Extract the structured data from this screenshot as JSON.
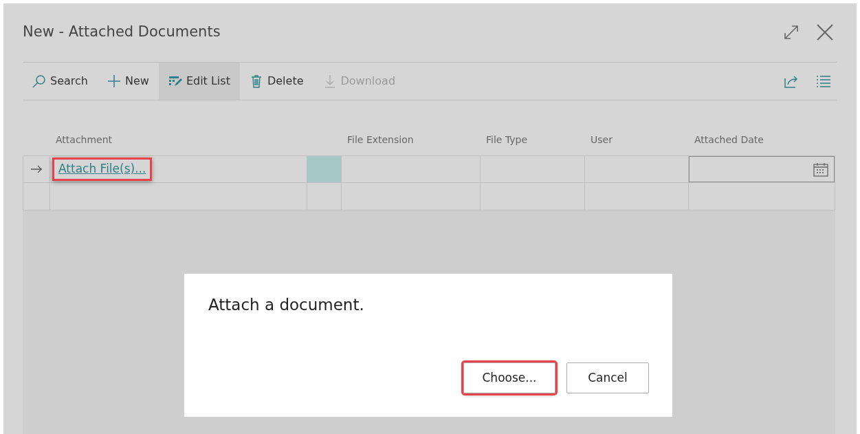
{
  "window": {
    "title": "New - Attached Documents"
  },
  "toolbar": {
    "actions": [
      {
        "kind": "search",
        "label": "Search",
        "selected": false,
        "disabled": false
      },
      {
        "kind": "new",
        "label": "New",
        "selected": false,
        "disabled": false
      },
      {
        "kind": "edit",
        "label": "Edit List",
        "selected": true,
        "disabled": false
      },
      {
        "kind": "delete",
        "label": "Delete",
        "selected": false,
        "disabled": false
      },
      {
        "kind": "download",
        "label": "Download",
        "selected": false,
        "disabled": true
      }
    ]
  },
  "table": {
    "columns": [
      {
        "kind": "text",
        "label": "Attachment"
      },
      {
        "kind": "blank"
      },
      {
        "kind": "text",
        "label": "File Extension"
      },
      {
        "kind": "text",
        "label": "File Type"
      },
      {
        "kind": "text",
        "label": "User"
      },
      {
        "kind": "text",
        "label": "Attached Date"
      }
    ],
    "rows": [
      {
        "current": true,
        "attachment": "Attach File(s)...",
        "highlighted": true,
        "date_field": true
      },
      {
        "current": false,
        "date_field": false
      }
    ]
  },
  "dialog": {
    "message": "Attach a document.",
    "buttons": [
      {
        "label": "Choose...",
        "highlighted": true
      },
      {
        "label": "Cancel",
        "highlighted": false
      }
    ]
  }
}
